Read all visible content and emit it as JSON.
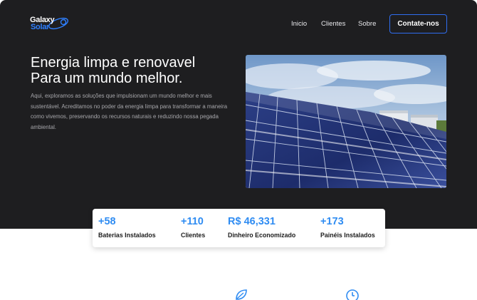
{
  "nav": {
    "logo_line1": "Galaxy",
    "logo_line2": "Solar",
    "links": [
      "Inicio",
      "Clientes",
      "Sobre"
    ],
    "cta": "Contate-nos"
  },
  "hero": {
    "headline_line1": "Energia limpa e renovavel",
    "headline_line2": "Para um mundo melhor.",
    "description": "Aqui, exploramos as soluções que impulsionam um mundo melhor e mais sustentável. Acreditamos no poder da energia limpa para transformar a maneira como vivemos, preservando os recursos naturais e reduzindo nossa pegada ambiental.",
    "image": "solar-panels-photo"
  },
  "stats": [
    {
      "value": "+58",
      "label": "Baterias Instalados"
    },
    {
      "value": "+110",
      "label": "Clientes"
    },
    {
      "value": "R$ 46,331",
      "label": "Dinheiro Economizado"
    },
    {
      "value": "+173",
      "label": "Painéis Instalados"
    }
  ],
  "colors": {
    "hero_bg": "#1e1e20",
    "accent": "#2f8cf2",
    "cta_border": "#2f6ef0"
  },
  "icons": [
    "leaf-icon",
    "clock-icon"
  ]
}
